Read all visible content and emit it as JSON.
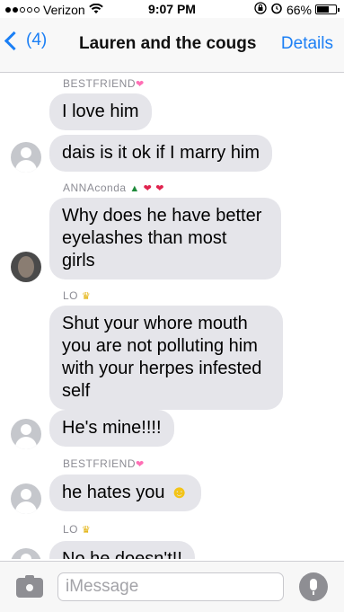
{
  "status_bar": {
    "carrier": "Verizon",
    "time": "9:07 PM",
    "battery": "66%",
    "battery_level": 0.66
  },
  "nav": {
    "back_count": "(4)",
    "title": "Lauren and the cougs",
    "details_label": "Details"
  },
  "messages": [
    {
      "sender": "BESTFRIEND",
      "text": "I love him"
    },
    {
      "text": "dais is it ok if I marry him"
    },
    {
      "sender": "ANNAconda",
      "text_lines": [
        "Why does he have better",
        "eyelashes than most",
        "girls"
      ]
    },
    {
      "sender": "LO",
      "text_lines": [
        "Shut your whore mouth",
        "you are not polluting him",
        "with your herpes infested",
        "self"
      ]
    },
    {
      "text": "He's mine!!!!"
    },
    {
      "sender": "BESTFRIEND",
      "text": "he hates you"
    },
    {
      "sender": "LO",
      "text": "No he doesn't!!"
    }
  ],
  "input": {
    "placeholder": "iMessage"
  },
  "icons": {
    "camera": "camera-icon",
    "microphone": "microphone-icon",
    "back": "chevron-left-icon",
    "wifi": "wifi-icon",
    "alarm": "alarm-icon",
    "lock_rotation": "rotation-lock-icon"
  },
  "colors": {
    "accent": "#1b7ff5",
    "bubble_gray": "#e5e5ea"
  }
}
